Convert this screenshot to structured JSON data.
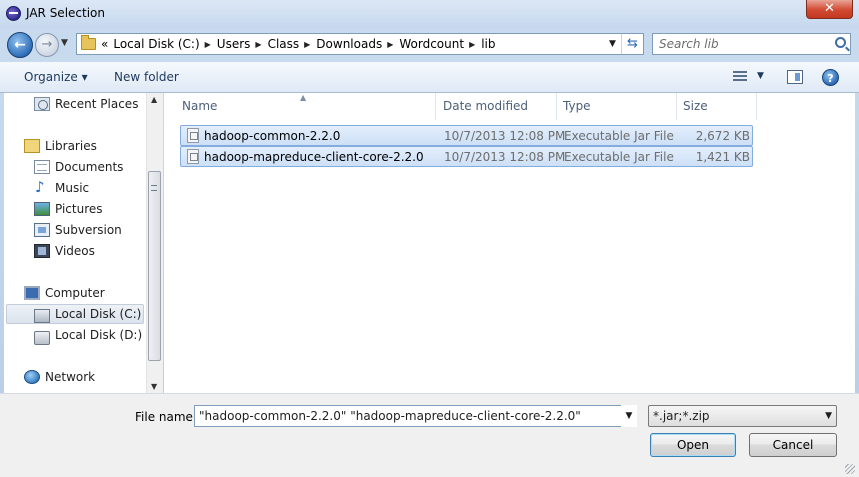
{
  "window": {
    "title": "JAR Selection",
    "close_label": "✕"
  },
  "nav": {
    "breadcrumbs": [
      "Local Disk (C:)",
      "Users",
      "Class",
      "Downloads",
      "Wordcount",
      "lib"
    ],
    "overflow": "«",
    "search_placeholder": "Search lib"
  },
  "toolbar": {
    "organize": "Organize ▾",
    "new_folder": "New folder"
  },
  "sidebar": {
    "items": [
      {
        "label": "Recent Places",
        "icon": "recent-places-icon"
      },
      {
        "label": "Libraries",
        "icon": "libraries-icon"
      },
      {
        "label": "Documents",
        "icon": "documents-icon"
      },
      {
        "label": "Music",
        "icon": "music-icon"
      },
      {
        "label": "Pictures",
        "icon": "pictures-icon"
      },
      {
        "label": "Subversion",
        "icon": "subversion-icon"
      },
      {
        "label": "Videos",
        "icon": "videos-icon"
      },
      {
        "label": "Computer",
        "icon": "computer-icon"
      },
      {
        "label": "Local Disk (C:)",
        "icon": "local-disk-icon",
        "selected": true
      },
      {
        "label": "Local Disk (D:)",
        "icon": "drive-icon"
      },
      {
        "label": "Network",
        "icon": "network-icon"
      }
    ]
  },
  "filelist": {
    "columns": [
      "Name",
      "Date modified",
      "Type",
      "Size"
    ],
    "rows": [
      {
        "name": "hadoop-common-2.2.0",
        "date": "10/7/2013 12:08 PM",
        "type": "Executable Jar File",
        "size": "2,672 KB"
      },
      {
        "name": "hadoop-mapreduce-client-core-2.2.0",
        "date": "10/7/2013 12:08 PM",
        "type": "Executable Jar File",
        "size": "1,421 KB"
      }
    ]
  },
  "footer": {
    "file_name_label": "File name:",
    "file_name_value": "\"hadoop-common-2.2.0\" \"hadoop-mapreduce-client-core-2.2.0\"",
    "filter_value": "*.jar;*.zip",
    "open_label": "Open",
    "cancel_label": "Cancel"
  }
}
